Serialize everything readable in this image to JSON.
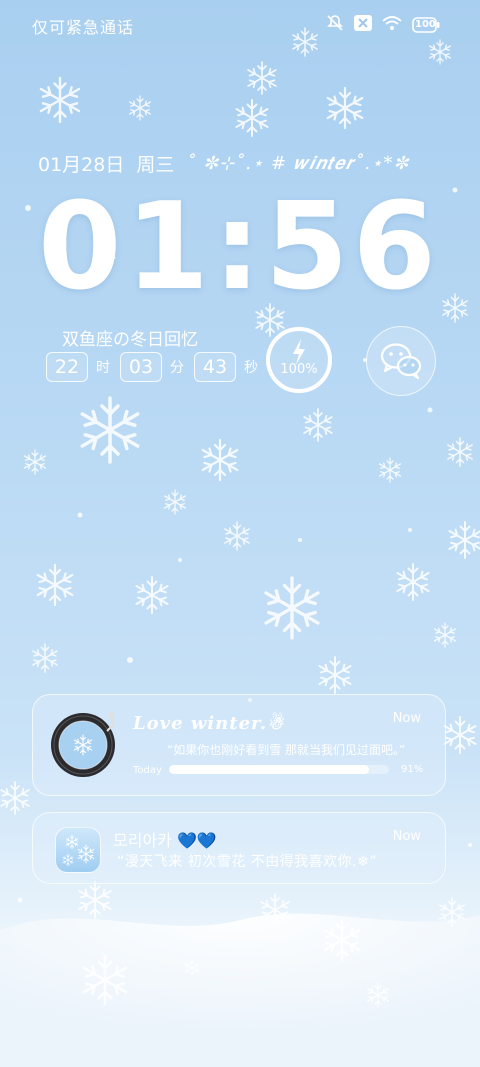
{
  "status_bar": {
    "text": "仅可紧急通话",
    "battery": "100",
    "icons": [
      "mute-icon",
      "no-sim-icon",
      "wifi-icon",
      "battery-icon"
    ]
  },
  "lockscreen": {
    "date": "01月28日",
    "weekday": "周三",
    "deco": "˚ ✼⊹˚.⋆ # 𝒘𝒊𝒏𝒕𝒆𝒓˚.⋆*✼",
    "time": "01:56",
    "memory_title": "双鱼座の冬日回忆",
    "countdown": {
      "hours": "22",
      "hours_unit": "时",
      "minutes": "03",
      "minutes_unit": "分",
      "seconds": "43",
      "seconds_unit": "秒"
    },
    "battery_widget": {
      "label": "100%",
      "level": 1.0
    }
  },
  "notifications": [
    {
      "title": "Love winter.☃",
      "time": "Now",
      "quote": "“如果你也刚好看到雪 那就当我们见过面吧。”",
      "progress_label": "Today",
      "progress_value": 0.91,
      "progress_text": "91%"
    },
    {
      "title": "모리아카 💙💙",
      "time": "Now",
      "body": "“漫天飞来 初次雪花 不由得我喜欢你.❄”"
    }
  ],
  "colors": {
    "sky_top": "#a9cff0",
    "sky_bottom": "#f8fbfe",
    "text": "#ffffff"
  }
}
